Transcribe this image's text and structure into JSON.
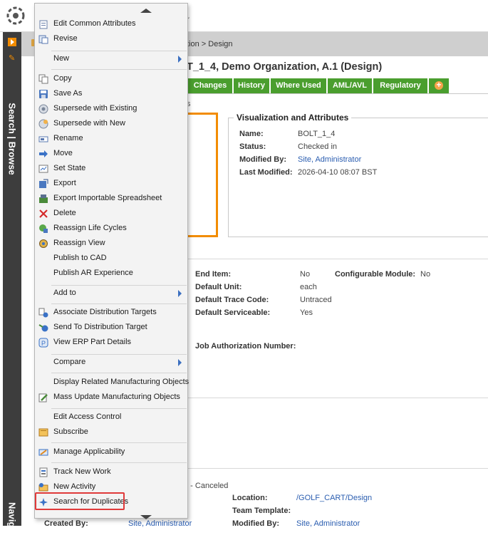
{
  "breadcrumb": {
    "text": "tion > Design"
  },
  "top_fragment": "r",
  "page_title": "T_1_4, Demo Organization, A.1 (Design)",
  "nav": {
    "search_browse": "Search | Browse",
    "navigator": "Navigator"
  },
  "tabs": [
    {
      "label": "Changes"
    },
    {
      "label": "History"
    },
    {
      "label": "Where Used"
    },
    {
      "label": "AML/AVL"
    },
    {
      "label": "Regulatory"
    }
  ],
  "tab_fragment": "s",
  "visualization": {
    "title": "Visualization and Attributes",
    "name_label": "Name:",
    "name_value": "BOLT_1_4",
    "status_label": "Status:",
    "status_value": "Checked in",
    "modified_by_label": "Modified By:",
    "modified_by_value": "Site, Administrator",
    "last_modified_label": "Last Modified:",
    "last_modified_value": "2026-04-10 08:07 BST"
  },
  "attributes": {
    "end_item_label": "End Item:",
    "end_item_value": "No",
    "configurable_module_label": "Configurable Module:",
    "configurable_module_value": "No",
    "default_unit_label": "Default Unit:",
    "default_unit_value": "each",
    "default_trace_label": "Default Trace Code:",
    "default_trace_value": "Untraced",
    "default_serviceable_label": "Default Serviceable:",
    "default_serviceable_value": "Yes",
    "job_auth_label": "Job Authorization Number:"
  },
  "bottom": {
    "canceled_fragment": "d - Canceled",
    "location_label": "Location:",
    "location_value": "/GOLF_CART/Design",
    "team_template_label": "Team Template:",
    "modified_by_label": "Modified By:",
    "modified_by_value": "Site, Administrator",
    "created_by_label": "Created By:",
    "created_by_value": "Site, Administrator"
  },
  "menu": {
    "items": [
      {
        "label": "Edit Common Attributes",
        "icon": "edit-attributes-icon"
      },
      {
        "label": "Revise",
        "icon": "revise-icon"
      },
      {
        "label": "New",
        "icon": "",
        "submenu": true
      },
      {
        "label": "Copy",
        "icon": "copy-icon"
      },
      {
        "label": "Save As",
        "icon": "save-as-icon"
      },
      {
        "label": "Supersede with Existing",
        "icon": "supersede-existing-icon"
      },
      {
        "label": "Supersede with New",
        "icon": "supersede-new-icon"
      },
      {
        "label": "Rename",
        "icon": "rename-icon"
      },
      {
        "label": "Move",
        "icon": "move-icon"
      },
      {
        "label": "Set State",
        "icon": "set-state-icon"
      },
      {
        "label": "Export",
        "icon": "export-icon"
      },
      {
        "label": "Export Importable Spreadsheet",
        "icon": "export-spreadsheet-icon"
      },
      {
        "label": "Delete",
        "icon": "delete-icon"
      },
      {
        "label": "Reassign Life Cycles",
        "icon": "reassign-lifecycle-icon"
      },
      {
        "label": "Reassign View",
        "icon": "reassign-view-icon"
      },
      {
        "label": "Publish to CAD",
        "icon": ""
      },
      {
        "label": "Publish AR Experience",
        "icon": ""
      },
      {
        "label": "Add to",
        "icon": "",
        "submenu": true
      },
      {
        "label": "Associate Distribution Targets",
        "icon": "associate-targets-icon"
      },
      {
        "label": "Send To Distribution Target",
        "icon": "send-target-icon"
      },
      {
        "label": "View ERP Part Details",
        "icon": "erp-details-icon"
      },
      {
        "label": "Compare",
        "icon": "",
        "submenu": true
      },
      {
        "label": "Display Related Manufacturing Objects",
        "icon": ""
      },
      {
        "label": "Mass Update Manufacturing Objects",
        "icon": "mass-update-icon"
      },
      {
        "label": "Edit Access Control",
        "icon": ""
      },
      {
        "label": "Subscribe",
        "icon": "subscribe-icon"
      },
      {
        "label": "Manage Applicability",
        "icon": "manage-applicability-icon"
      },
      {
        "label": "Track New Work",
        "icon": "track-work-icon"
      },
      {
        "label": "New Activity",
        "icon": "new-activity-icon"
      },
      {
        "label": "Search for Duplicates",
        "icon": "search-duplicates-icon"
      }
    ]
  },
  "colors": {
    "tab_green": "#4a9e2e",
    "accent_orange": "#f28c00",
    "highlight_red": "#e03a3a"
  }
}
